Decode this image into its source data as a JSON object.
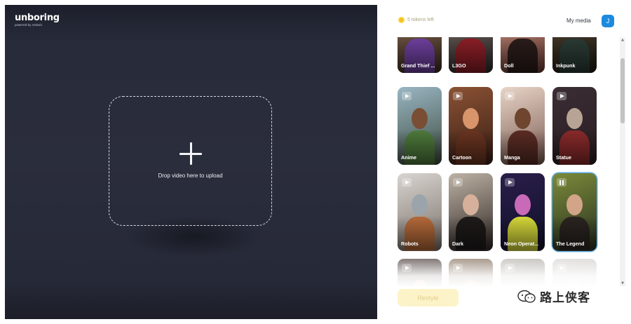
{
  "app": {
    "logo_title": "unboring",
    "logo_subtitle": "powered by netaxis"
  },
  "upload": {
    "drop_text": "Drop video here to upload"
  },
  "header": {
    "tokens_text": "5 tokens left",
    "my_media_label": "My media",
    "avatar_initial": "J"
  },
  "styles": [
    {
      "label": "Grand Thief ...",
      "bg1": "#8a6a50",
      "bg2": "#3c2c24",
      "skin": "#a26a44",
      "cloth": "#6d3f9c",
      "playing": false
    },
    {
      "label": "L3GO",
      "bg1": "#7a6a60",
      "bg2": "#2e2a2c",
      "skin": "#b07a5a",
      "cloth": "#8a1e26",
      "playing": false
    },
    {
      "label": "Doll",
      "bg1": "#c99a86",
      "bg2": "#6a3a34",
      "skin": "#e2b49a",
      "cloth": "#2a1c1a",
      "playing": false
    },
    {
      "label": "Inkpunk",
      "bg1": "#5a4a34",
      "bg2": "#1e1a14",
      "skin": "#d6a84a",
      "cloth": "#2a3a34",
      "playing": false
    },
    {
      "label": "Anime",
      "bg1": "#9ab6c4",
      "bg2": "#3c4a3c",
      "skin": "#7a4e34",
      "cloth": "#4e7a3c",
      "playing": false
    },
    {
      "label": "Cartoon",
      "bg1": "#8a5234",
      "bg2": "#3a1e14",
      "skin": "#d8946a",
      "cloth": "#6a3420",
      "playing": false
    },
    {
      "label": "Manga",
      "bg1": "#e8d4c8",
      "bg2": "#7a5a50",
      "skin": "#6e4630",
      "cloth": "#5a2c24",
      "playing": false
    },
    {
      "label": "Statue",
      "bg1": "#3a2e34",
      "bg2": "#2a1c22",
      "skin": "#b8a494",
      "cloth": "#8a2a2a",
      "playing": false
    },
    {
      "label": "Robots",
      "bg1": "#d8d4d0",
      "bg2": "#7a7068",
      "skin": "#9aa4aa",
      "cloth": "#b46a3a",
      "playing": false
    },
    {
      "label": "Dark",
      "bg1": "#bdb2a4",
      "bg2": "#2e2624",
      "skin": "#d6b09a",
      "cloth": "#1e1a1a",
      "playing": false
    },
    {
      "label": "Neon Operat...",
      "bg1": "#2a1e4a",
      "bg2": "#10102a",
      "skin": "#c86ab8",
      "cloth": "#d6d83a",
      "playing": false
    },
    {
      "label": "The Legend",
      "bg1": "#7a8a3a",
      "bg2": "#2a3020",
      "skin": "#d2a488",
      "cloth": "#2a2420",
      "playing": true
    },
    {
      "label": "",
      "bg1": "#4a3c38",
      "bg2": "#2a2220",
      "skin": "#c07a5a",
      "cloth": "#7a2a24",
      "playing": false
    },
    {
      "label": "",
      "bg1": "#8a7460",
      "bg2": "#4a3a2c",
      "skin": "#c8a07a",
      "cloth": "#5a4030",
      "playing": false
    },
    {
      "label": "",
      "bg1": "#bcb8b0",
      "bg2": "#7a766e",
      "skin": "#d0c4b4",
      "cloth": "#9a948a",
      "playing": false
    },
    {
      "label": "",
      "bg1": "#d8d6d4",
      "bg2": "#b0aca8",
      "skin": "#e0dcd6",
      "cloth": "#c8c4bc",
      "playing": false
    }
  ],
  "actions": {
    "restyle_label": "Restyle"
  },
  "watermark": {
    "text": "路上侠客"
  },
  "colors": {
    "accent_blue": "#1b8be0",
    "selected_outline": "#5aa9e6",
    "token_coin": "#f4c21f",
    "restyle_bg": "#fdf3c8"
  }
}
